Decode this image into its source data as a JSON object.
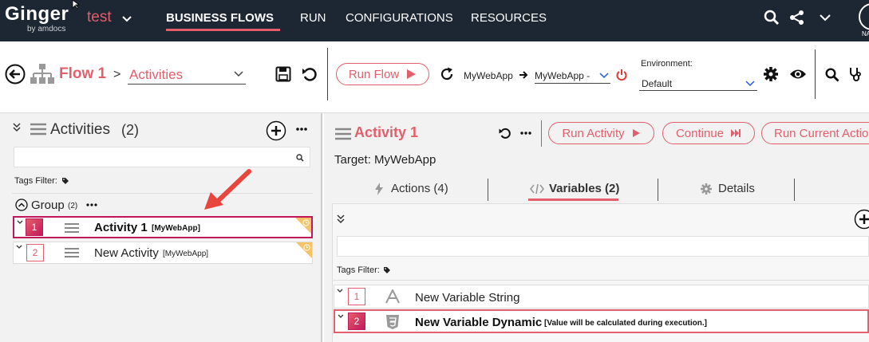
{
  "app": {
    "logo": "Ginger",
    "logo_sub": "by amdocs",
    "solution_name": "test",
    "user_initials": "NA"
  },
  "nav": {
    "items": [
      {
        "label": "BUSINESS FLOWS",
        "active": true
      },
      {
        "label": "RUN"
      },
      {
        "label": "CONFIGURATIONS"
      },
      {
        "label": "RESOURCES"
      }
    ]
  },
  "toolbar": {
    "breadcrumb_flow": "Flow 1",
    "breadcrumb_sep": ">",
    "breadcrumb_current": "Activities",
    "run_flow_label": "Run Flow",
    "target_app": "MyWebApp",
    "target_mapping": "MyWebApp -",
    "environment_label": "Environment:",
    "environment_value": "Default"
  },
  "activities_panel": {
    "title": "Activities",
    "count": "(2)",
    "tags_filter_label": "Tags Filter:",
    "group_label": "Group",
    "group_count": "(2)",
    "activities": [
      {
        "number": "1",
        "name": "Activity 1",
        "target": "[MyWebApp]",
        "selected": true
      },
      {
        "number": "2",
        "name": "New Activity",
        "target": "[MyWebApp]",
        "selected": false
      }
    ]
  },
  "activity_detail": {
    "title": "Activity 1",
    "run_activity_label": "Run Activity",
    "continue_label": "Continue",
    "run_current_action_label": "Run Current Actio",
    "target_line": "Target: MyWebApp",
    "tabs": [
      {
        "label": "Actions (4)",
        "icon": "bolt-icon"
      },
      {
        "label": "Variables (2)",
        "icon": "code-icon",
        "active": true
      },
      {
        "label": "Details",
        "icon": "gear-icon"
      }
    ],
    "tags_filter_label": "Tags Filter:",
    "variables": [
      {
        "number": "1",
        "name": "New Variable String",
        "note": "",
        "selected": false,
        "icon": "letter-a-icon"
      },
      {
        "number": "2",
        "name": "New Variable Dynamic",
        "note": "[Value will be calculated during execution.]",
        "selected": true,
        "icon": "css-icon"
      }
    ]
  },
  "colors": {
    "accent": "#e35f6b",
    "topbar": "#1d2633",
    "selected_border": "#c2185b",
    "panel_bg": "#f2f2f2"
  }
}
